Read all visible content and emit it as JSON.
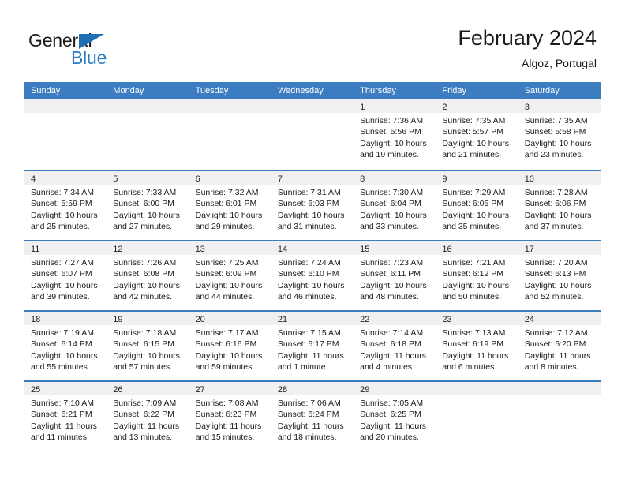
{
  "brand": {
    "name_part1": "General",
    "name_part2": "Blue",
    "triangle_color": "#1f6fb5",
    "blue_color": "#2b7cc4"
  },
  "header": {
    "title": "February 2024",
    "subtitle": "Algoz, Portugal"
  },
  "theme": {
    "header_bg": "#3b7dc0",
    "day_band_bg": "#f0f0f0",
    "cell_bg": "#ffffff",
    "text_color": "#1a1a1a"
  },
  "weekdays": [
    "Sunday",
    "Monday",
    "Tuesday",
    "Wednesday",
    "Thursday",
    "Friday",
    "Saturday"
  ],
  "weeks": [
    [
      {
        "day": "",
        "sunrise": "",
        "sunset": "",
        "daylight_line1": "",
        "daylight_line2": ""
      },
      {
        "day": "",
        "sunrise": "",
        "sunset": "",
        "daylight_line1": "",
        "daylight_line2": ""
      },
      {
        "day": "",
        "sunrise": "",
        "sunset": "",
        "daylight_line1": "",
        "daylight_line2": ""
      },
      {
        "day": "",
        "sunrise": "",
        "sunset": "",
        "daylight_line1": "",
        "daylight_line2": ""
      },
      {
        "day": "1",
        "sunrise": "Sunrise: 7:36 AM",
        "sunset": "Sunset: 5:56 PM",
        "daylight_line1": "Daylight: 10 hours",
        "daylight_line2": "and 19 minutes."
      },
      {
        "day": "2",
        "sunrise": "Sunrise: 7:35 AM",
        "sunset": "Sunset: 5:57 PM",
        "daylight_line1": "Daylight: 10 hours",
        "daylight_line2": "and 21 minutes."
      },
      {
        "day": "3",
        "sunrise": "Sunrise: 7:35 AM",
        "sunset": "Sunset: 5:58 PM",
        "daylight_line1": "Daylight: 10 hours",
        "daylight_line2": "and 23 minutes."
      }
    ],
    [
      {
        "day": "4",
        "sunrise": "Sunrise: 7:34 AM",
        "sunset": "Sunset: 5:59 PM",
        "daylight_line1": "Daylight: 10 hours",
        "daylight_line2": "and 25 minutes."
      },
      {
        "day": "5",
        "sunrise": "Sunrise: 7:33 AM",
        "sunset": "Sunset: 6:00 PM",
        "daylight_line1": "Daylight: 10 hours",
        "daylight_line2": "and 27 minutes."
      },
      {
        "day": "6",
        "sunrise": "Sunrise: 7:32 AM",
        "sunset": "Sunset: 6:01 PM",
        "daylight_line1": "Daylight: 10 hours",
        "daylight_line2": "and 29 minutes."
      },
      {
        "day": "7",
        "sunrise": "Sunrise: 7:31 AM",
        "sunset": "Sunset: 6:03 PM",
        "daylight_line1": "Daylight: 10 hours",
        "daylight_line2": "and 31 minutes."
      },
      {
        "day": "8",
        "sunrise": "Sunrise: 7:30 AM",
        "sunset": "Sunset: 6:04 PM",
        "daylight_line1": "Daylight: 10 hours",
        "daylight_line2": "and 33 minutes."
      },
      {
        "day": "9",
        "sunrise": "Sunrise: 7:29 AM",
        "sunset": "Sunset: 6:05 PM",
        "daylight_line1": "Daylight: 10 hours",
        "daylight_line2": "and 35 minutes."
      },
      {
        "day": "10",
        "sunrise": "Sunrise: 7:28 AM",
        "sunset": "Sunset: 6:06 PM",
        "daylight_line1": "Daylight: 10 hours",
        "daylight_line2": "and 37 minutes."
      }
    ],
    [
      {
        "day": "11",
        "sunrise": "Sunrise: 7:27 AM",
        "sunset": "Sunset: 6:07 PM",
        "daylight_line1": "Daylight: 10 hours",
        "daylight_line2": "and 39 minutes."
      },
      {
        "day": "12",
        "sunrise": "Sunrise: 7:26 AM",
        "sunset": "Sunset: 6:08 PM",
        "daylight_line1": "Daylight: 10 hours",
        "daylight_line2": "and 42 minutes."
      },
      {
        "day": "13",
        "sunrise": "Sunrise: 7:25 AM",
        "sunset": "Sunset: 6:09 PM",
        "daylight_line1": "Daylight: 10 hours",
        "daylight_line2": "and 44 minutes."
      },
      {
        "day": "14",
        "sunrise": "Sunrise: 7:24 AM",
        "sunset": "Sunset: 6:10 PM",
        "daylight_line1": "Daylight: 10 hours",
        "daylight_line2": "and 46 minutes."
      },
      {
        "day": "15",
        "sunrise": "Sunrise: 7:23 AM",
        "sunset": "Sunset: 6:11 PM",
        "daylight_line1": "Daylight: 10 hours",
        "daylight_line2": "and 48 minutes."
      },
      {
        "day": "16",
        "sunrise": "Sunrise: 7:21 AM",
        "sunset": "Sunset: 6:12 PM",
        "daylight_line1": "Daylight: 10 hours",
        "daylight_line2": "and 50 minutes."
      },
      {
        "day": "17",
        "sunrise": "Sunrise: 7:20 AM",
        "sunset": "Sunset: 6:13 PM",
        "daylight_line1": "Daylight: 10 hours",
        "daylight_line2": "and 52 minutes."
      }
    ],
    [
      {
        "day": "18",
        "sunrise": "Sunrise: 7:19 AM",
        "sunset": "Sunset: 6:14 PM",
        "daylight_line1": "Daylight: 10 hours",
        "daylight_line2": "and 55 minutes."
      },
      {
        "day": "19",
        "sunrise": "Sunrise: 7:18 AM",
        "sunset": "Sunset: 6:15 PM",
        "daylight_line1": "Daylight: 10 hours",
        "daylight_line2": "and 57 minutes."
      },
      {
        "day": "20",
        "sunrise": "Sunrise: 7:17 AM",
        "sunset": "Sunset: 6:16 PM",
        "daylight_line1": "Daylight: 10 hours",
        "daylight_line2": "and 59 minutes."
      },
      {
        "day": "21",
        "sunrise": "Sunrise: 7:15 AM",
        "sunset": "Sunset: 6:17 PM",
        "daylight_line1": "Daylight: 11 hours",
        "daylight_line2": "and 1 minute."
      },
      {
        "day": "22",
        "sunrise": "Sunrise: 7:14 AM",
        "sunset": "Sunset: 6:18 PM",
        "daylight_line1": "Daylight: 11 hours",
        "daylight_line2": "and 4 minutes."
      },
      {
        "day": "23",
        "sunrise": "Sunrise: 7:13 AM",
        "sunset": "Sunset: 6:19 PM",
        "daylight_line1": "Daylight: 11 hours",
        "daylight_line2": "and 6 minutes."
      },
      {
        "day": "24",
        "sunrise": "Sunrise: 7:12 AM",
        "sunset": "Sunset: 6:20 PM",
        "daylight_line1": "Daylight: 11 hours",
        "daylight_line2": "and 8 minutes."
      }
    ],
    [
      {
        "day": "25",
        "sunrise": "Sunrise: 7:10 AM",
        "sunset": "Sunset: 6:21 PM",
        "daylight_line1": "Daylight: 11 hours",
        "daylight_line2": "and 11 minutes."
      },
      {
        "day": "26",
        "sunrise": "Sunrise: 7:09 AM",
        "sunset": "Sunset: 6:22 PM",
        "daylight_line1": "Daylight: 11 hours",
        "daylight_line2": "and 13 minutes."
      },
      {
        "day": "27",
        "sunrise": "Sunrise: 7:08 AM",
        "sunset": "Sunset: 6:23 PM",
        "daylight_line1": "Daylight: 11 hours",
        "daylight_line2": "and 15 minutes."
      },
      {
        "day": "28",
        "sunrise": "Sunrise: 7:06 AM",
        "sunset": "Sunset: 6:24 PM",
        "daylight_line1": "Daylight: 11 hours",
        "daylight_line2": "and 18 minutes."
      },
      {
        "day": "29",
        "sunrise": "Sunrise: 7:05 AM",
        "sunset": "Sunset: 6:25 PM",
        "daylight_line1": "Daylight: 11 hours",
        "daylight_line2": "and 20 minutes."
      },
      {
        "day": "",
        "sunrise": "",
        "sunset": "",
        "daylight_line1": "",
        "daylight_line2": ""
      },
      {
        "day": "",
        "sunrise": "",
        "sunset": "",
        "daylight_line1": "",
        "daylight_line2": ""
      }
    ]
  ]
}
